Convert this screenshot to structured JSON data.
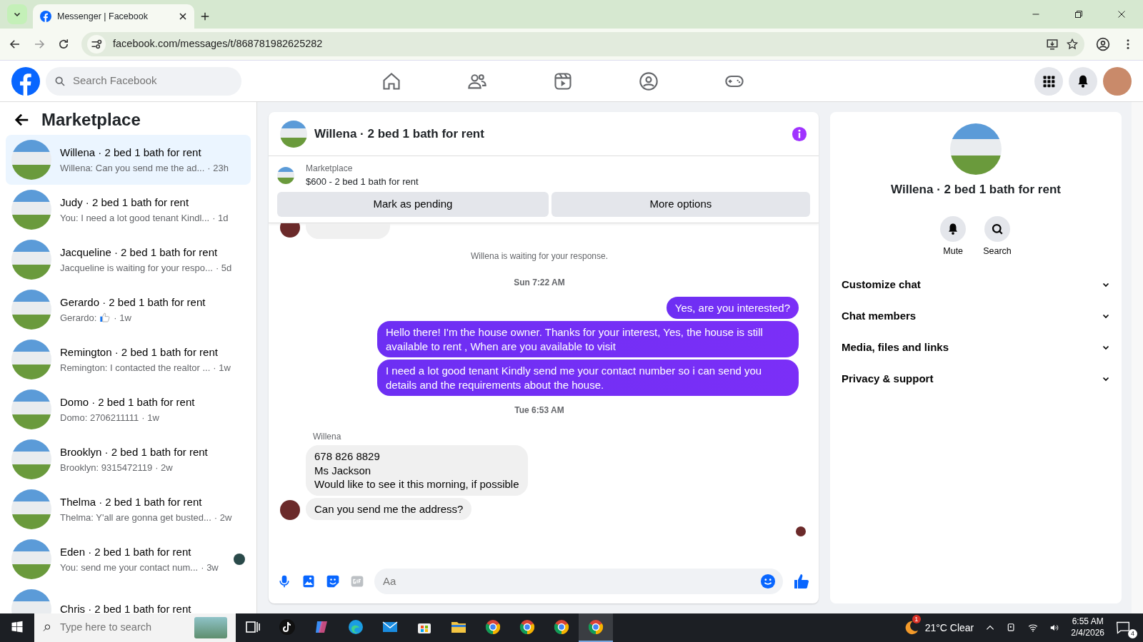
{
  "browser": {
    "tab_title": "Messenger | Facebook",
    "url": "facebook.com/messages/t/868781982625282"
  },
  "header": {
    "search_placeholder": "Search Facebook"
  },
  "sidebar": {
    "title": "Marketplace",
    "conversations": [
      {
        "title": "Willena · 2 bed 1 bath for rent",
        "preview": "Willena: Can you send me the ad...",
        "time": "· 23h",
        "selected": true
      },
      {
        "title": "Judy · 2 bed 1 bath for rent",
        "preview": "You: I need a lot good tenant Kindl...",
        "time": "· 1d",
        "selected": false
      },
      {
        "title": "Jacqueline · 2 bed 1 bath for rent",
        "preview": "Jacqueline is waiting for your respo...",
        "time": "· 5d",
        "selected": false
      },
      {
        "title": "Gerardo · 2 bed 1 bath for rent",
        "preview": "Gerardo:",
        "kind": "like",
        "time": "· 1w",
        "selected": false
      },
      {
        "title": "Remington · 2 bed 1 bath for rent",
        "preview": "Remington: I contacted the realtor ...",
        "time": "· 1w",
        "selected": false
      },
      {
        "title": "Domo · 2 bed 1 bath for rent",
        "preview": "Domo: 2706211111",
        "time": "· 1w",
        "selected": false
      },
      {
        "title": "Brooklyn · 2 bed 1 bath for rent",
        "preview": "Brooklyn: 9315472119",
        "time": "· 2w",
        "selected": false
      },
      {
        "title": "Thelma · 2 bed 1 bath for rent",
        "preview": "Thelma: Y'all are gonna get busted...",
        "time": "· 2w",
        "selected": false
      },
      {
        "title": "Eden · 2 bed 1 bath for rent",
        "preview": "You: send me your contact num...",
        "time": "· 3w",
        "seen": true,
        "selected": false
      },
      {
        "title": "Chris · 2 bed 1 bath for rent",
        "selected": false
      }
    ]
  },
  "chat": {
    "title": "Willena · 2 bed 1 bath for rent",
    "listing": {
      "label": "Marketplace",
      "price_title": "$600 - 2 bed 1 bath for rent"
    },
    "actions": [
      "Mark as pending",
      "More options"
    ],
    "messages": [
      {
        "kind": "incoming_hidden"
      },
      {
        "kind": "notice",
        "text": "Willena is waiting for your response."
      },
      {
        "kind": "time",
        "text": "Sun 7:22 AM"
      },
      {
        "kind": "outgoing",
        "text": "Yes, are you interested?"
      },
      {
        "kind": "outgoing",
        "text": "Hello there! I'm the house owner. Thanks for your interest, Yes, the house is still available to rent , When are you available to visit"
      },
      {
        "kind": "outgoing",
        "text": "I need a lot good tenant Kindly send me your contact number so i can send you details and the requirements about the house."
      },
      {
        "kind": "time",
        "text": "Tue 6:53 AM"
      },
      {
        "kind": "sender",
        "text": "Willena"
      },
      {
        "kind": "incoming",
        "text": "678 826 8829\nMs Jackson\nWould like to see it this morning, if possible"
      },
      {
        "kind": "incoming",
        "text": "Can you send me the address?",
        "avatar": true
      }
    ],
    "composer_placeholder": "Aa"
  },
  "details": {
    "title": "Willena · 2 bed 1 bath for rent",
    "actions": [
      "Mute",
      "Search"
    ],
    "sections": [
      {
        "label": "Customize chat",
        "expanded": false
      },
      {
        "label": "Chat members",
        "expanded": false
      },
      {
        "label": "Media, files and links",
        "expanded": false
      },
      {
        "label": "Privacy & support",
        "expanded": false
      }
    ]
  },
  "taskbar": {
    "search_placeholder": "Type here to search",
    "weather_badge": "1",
    "weather": "21°C Clear",
    "time": "6:55 AM",
    "date": "2/4/2026",
    "notifications": "4",
    "apps": [
      {
        "kind": "taskview",
        "selected": false
      },
      {
        "kind": "tiktok",
        "selected": false
      },
      {
        "kind": "copilot",
        "selected": false
      },
      {
        "kind": "edge",
        "selected": false
      },
      {
        "kind": "mail",
        "selected": false
      },
      {
        "kind": "store",
        "selected": false
      },
      {
        "kind": "files",
        "selected": false
      },
      {
        "kind": "chrome",
        "selected": false
      },
      {
        "kind": "chrome",
        "selected": false
      },
      {
        "kind": "chrome",
        "selected": false
      },
      {
        "kind": "chrome",
        "selected": true
      }
    ]
  }
}
